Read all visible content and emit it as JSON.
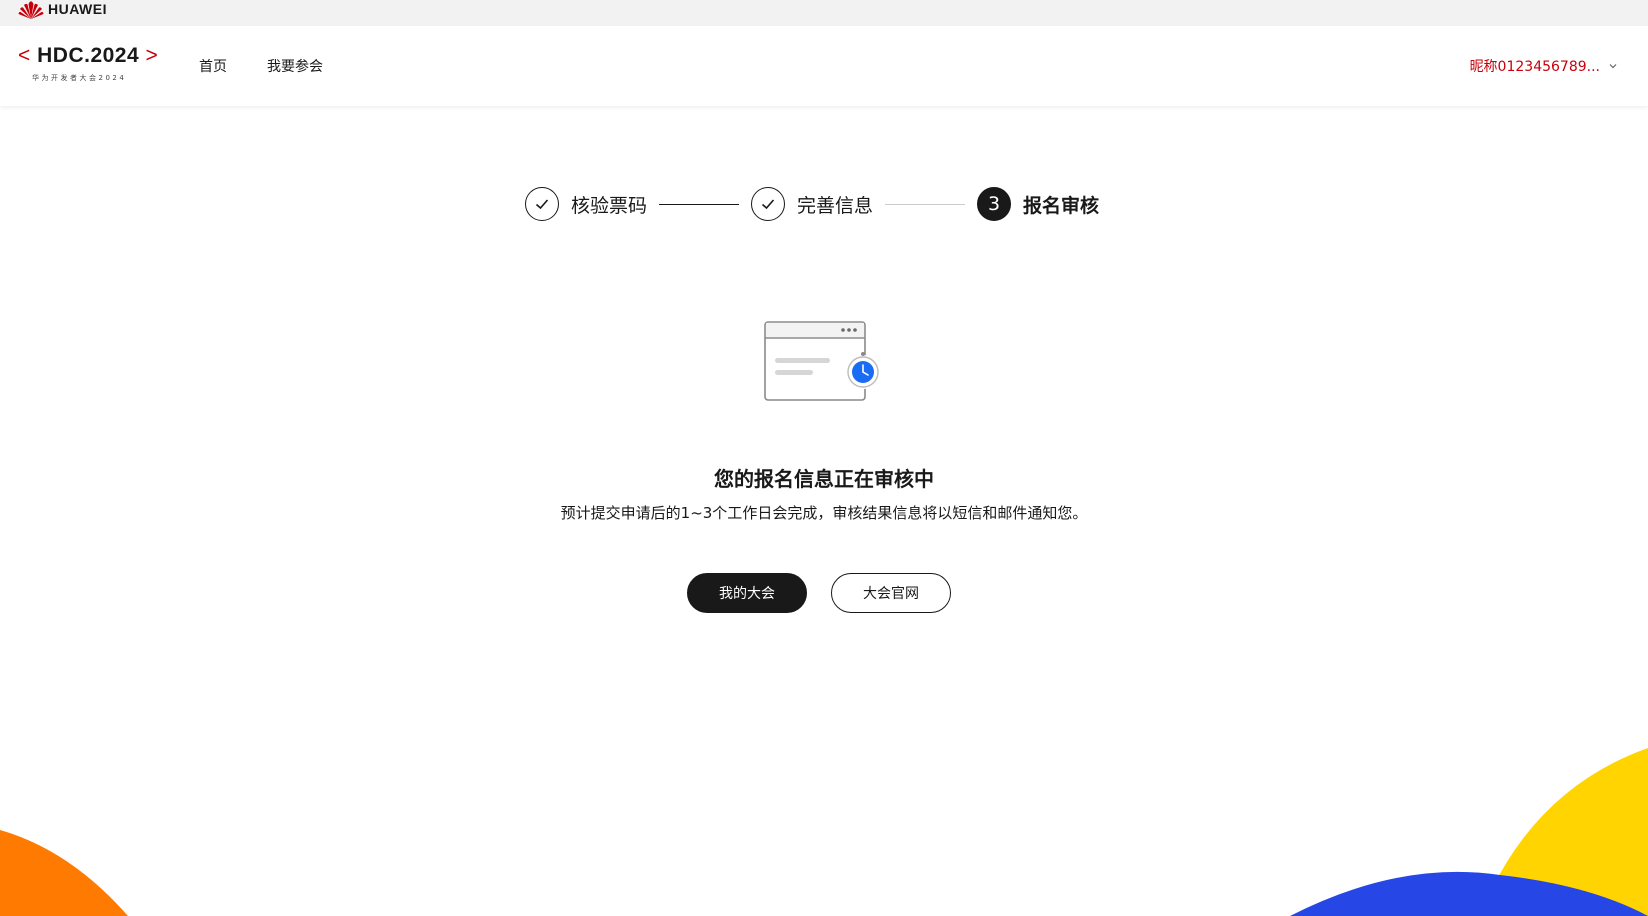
{
  "topbar": {
    "brand": "HUAWEI"
  },
  "header": {
    "logo_title": "HDC.2024",
    "logo_left_bracket": "<",
    "logo_right_bracket": ">",
    "logo_subtitle": "华为开发者大会2024",
    "nav": [
      {
        "label": "首页"
      },
      {
        "label": "我要参会"
      }
    ],
    "user_name": "昵称0123456789..."
  },
  "steps": [
    {
      "label": "核验票码",
      "state": "done"
    },
    {
      "label": "完善信息",
      "state": "done"
    },
    {
      "label": "报名审核",
      "state": "active",
      "number": "3"
    }
  ],
  "status": {
    "title": "您的报名信息正在审核中",
    "description": "预计提交申请后的1~3个工作日会完成，审核结果信息将以短信和邮件通知您。"
  },
  "buttons": {
    "primary": "我的大会",
    "secondary": "大会官网"
  },
  "colors": {
    "brand_red": "#c7000b",
    "primary_dark": "#191919",
    "clock_blue": "#1a6cf4",
    "deco_orange": "#ff7a00",
    "deco_yellow": "#ffd400",
    "deco_blue": "#2746e6"
  }
}
